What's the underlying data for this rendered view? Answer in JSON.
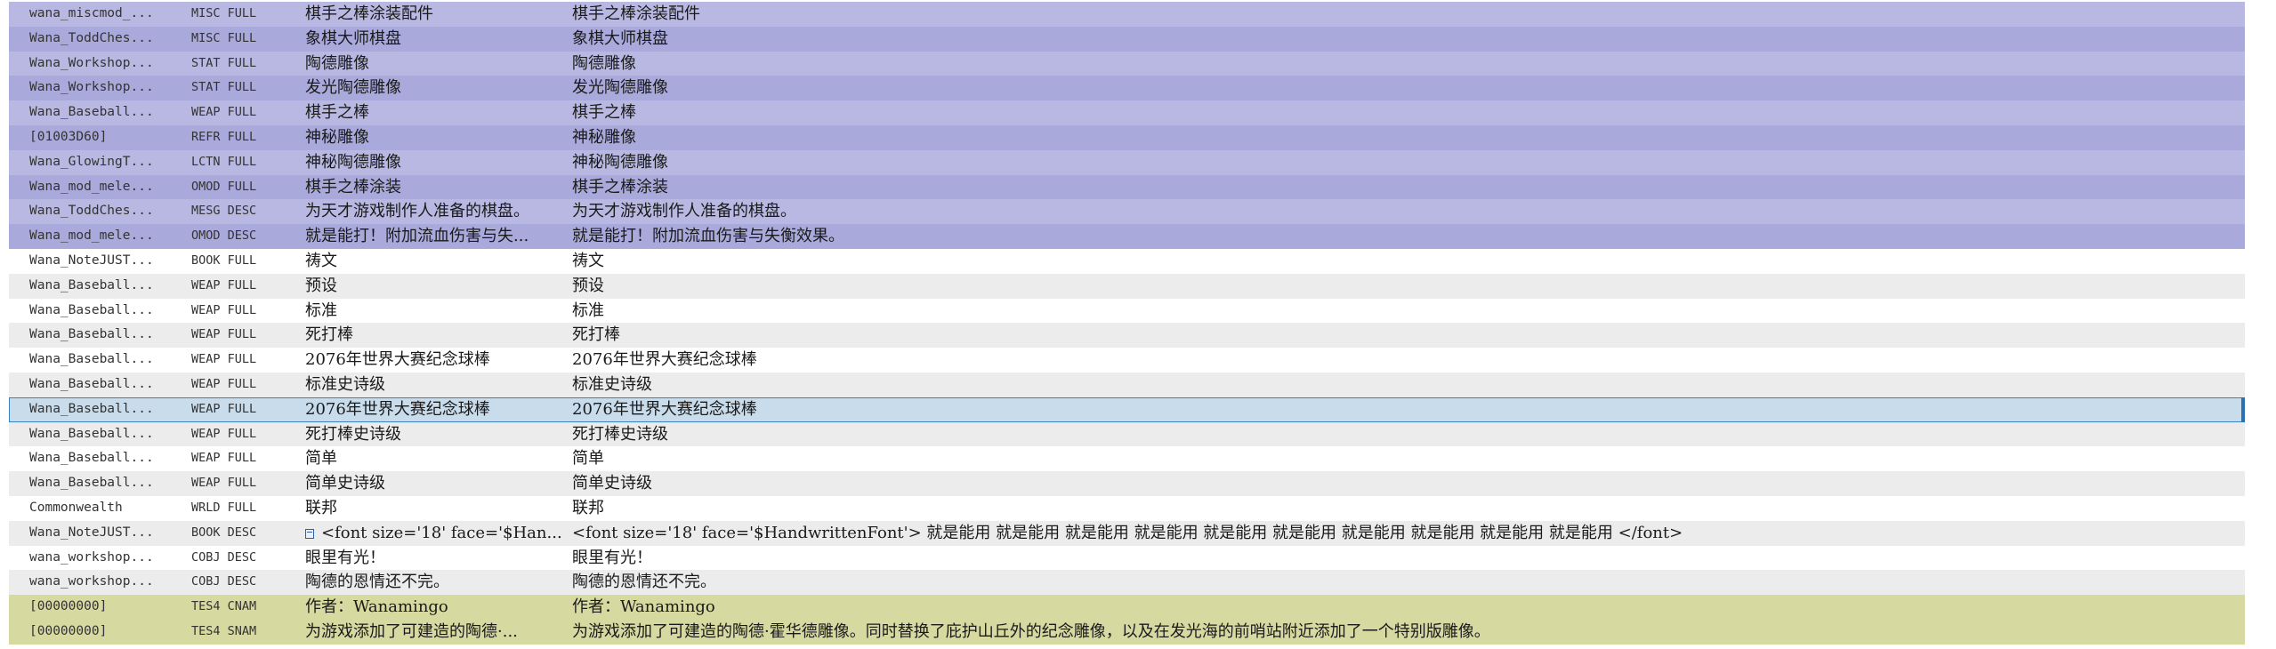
{
  "rows": [
    {
      "edid": "wana_miscmod_...",
      "type": "MISC FULL",
      "source": "棋手之棒涂装配件",
      "dest": "棋手之棒涂装配件",
      "style": "purple-a",
      "icon": false
    },
    {
      "edid": "Wana_ToddChes...",
      "type": "MISC FULL",
      "source": "象棋大师棋盘",
      "dest": "象棋大师棋盘",
      "style": "purple-b",
      "icon": false
    },
    {
      "edid": "Wana_Workshop...",
      "type": "STAT FULL",
      "source": "陶德雕像",
      "dest": "陶德雕像",
      "style": "purple-a",
      "icon": false
    },
    {
      "edid": "Wana_Workshop...",
      "type": "STAT FULL",
      "source": "发光陶德雕像",
      "dest": "发光陶德雕像",
      "style": "purple-b",
      "icon": false
    },
    {
      "edid": "Wana_Baseball...",
      "type": "WEAP FULL",
      "source": "棋手之棒",
      "dest": "棋手之棒",
      "style": "purple-a",
      "icon": false
    },
    {
      "edid": "[01003D60]",
      "type": "REFR FULL",
      "source": "神秘雕像",
      "dest": "神秘雕像",
      "style": "purple-b",
      "icon": false
    },
    {
      "edid": "Wana_GlowingT...",
      "type": "LCTN FULL",
      "source": "神秘陶德雕像",
      "dest": "神秘陶德雕像",
      "style": "purple-a",
      "icon": false
    },
    {
      "edid": "Wana_mod_mele...",
      "type": "OMOD FULL",
      "source": "棋手之棒涂装",
      "dest": "棋手之棒涂装",
      "style": "purple-b",
      "icon": false
    },
    {
      "edid": "Wana_ToddChes...",
      "type": "MESG DESC",
      "source": "为天才游戏制作人准备的棋盘。",
      "dest": "为天才游戏制作人准备的棋盘。",
      "style": "purple-a",
      "icon": false
    },
    {
      "edid": "Wana_mod_mele...",
      "type": "OMOD DESC",
      "source": "就是能打！附加流血伤害与失...",
      "dest": "就是能打！附加流血伤害与失衡效果。",
      "style": "purple-b",
      "icon": false
    },
    {
      "edid": "Wana_NoteJUST...",
      "type": "BOOK FULL",
      "source": "祷文",
      "dest": "祷文",
      "style": "plain-a",
      "icon": false
    },
    {
      "edid": "Wana_Baseball...",
      "type": "WEAP FULL",
      "source": "预设",
      "dest": "预设",
      "style": "plain-b",
      "icon": false
    },
    {
      "edid": "Wana_Baseball...",
      "type": "WEAP FULL",
      "source": "标准",
      "dest": "标准",
      "style": "plain-a",
      "icon": false
    },
    {
      "edid": "Wana_Baseball...",
      "type": "WEAP FULL",
      "source": "死打棒",
      "dest": "死打棒",
      "style": "plain-b",
      "icon": false
    },
    {
      "edid": "Wana_Baseball...",
      "type": "WEAP FULL",
      "source": "2076年世界大赛纪念球棒",
      "dest": "2076年世界大赛纪念球棒",
      "style": "plain-a",
      "icon": false
    },
    {
      "edid": "Wana_Baseball...",
      "type": "WEAP FULL",
      "source": "标准史诗级",
      "dest": "标准史诗级",
      "style": "plain-b",
      "icon": false
    },
    {
      "edid": "Wana_Baseball...",
      "type": "WEAP FULL",
      "source": "2076年世界大赛纪念球棒",
      "dest": "2076年世界大赛纪念球棒",
      "style": "selected",
      "icon": false
    },
    {
      "edid": "Wana_Baseball...",
      "type": "WEAP FULL",
      "source": "死打棒史诗级",
      "dest": "死打棒史诗级",
      "style": "plain-b",
      "icon": false
    },
    {
      "edid": "Wana_Baseball...",
      "type": "WEAP FULL",
      "source": "简单",
      "dest": "简单",
      "style": "plain-a",
      "icon": false
    },
    {
      "edid": "Wana_Baseball...",
      "type": "WEAP FULL",
      "source": "简单史诗级",
      "dest": "简单史诗级",
      "style": "plain-b",
      "icon": false
    },
    {
      "edid": "Commonwealth",
      "type": "WRLD FULL",
      "source": "联邦",
      "dest": "联邦",
      "style": "plain-a",
      "icon": false
    },
    {
      "edid": "Wana_NoteJUST...",
      "type": "BOOK DESC",
      "source": "<font size='18' face='$Han...",
      "dest": "<font size='18' face='$HandwrittenFont'>  就是能用  就是能用  就是能用  就是能用  就是能用  就是能用  就是能用  就是能用  就是能用  就是能用  </font>",
      "style": "plain-b",
      "icon": true
    },
    {
      "edid": "wana_workshop...",
      "type": "COBJ DESC",
      "source": "眼里有光！",
      "dest": "眼里有光！",
      "style": "plain-a",
      "icon": false
    },
    {
      "edid": "wana_workshop...",
      "type": "COBJ DESC",
      "source": "陶德的恩情还不完。",
      "dest": "陶德的恩情还不完。",
      "style": "plain-b",
      "icon": false
    },
    {
      "edid": "[00000000]",
      "type": "TES4 CNAM",
      "source": "作者：Wanamingo",
      "dest": "作者：Wanamingo",
      "style": "olive",
      "icon": false
    },
    {
      "edid": "[00000000]",
      "type": "TES4 SNAM",
      "source": "为游戏添加了可建造的陶德·...",
      "dest": "为游戏添加了可建造的陶德·霍华德雕像。同时替换了庇护山丘外的纪念雕像，以及在发光海的前哨站附近添加了一个特别版雕像。",
      "style": "olive",
      "icon": false
    }
  ],
  "colors": {
    "purple_row_a": "#b8b8e2",
    "purple_row_b": "#a9a9dc",
    "olive_row": "#d6d9a0",
    "selected_row": "#c9dcec",
    "selection_border": "#2a6fb0"
  },
  "icons": {
    "book_desc_row": "document-icon"
  }
}
